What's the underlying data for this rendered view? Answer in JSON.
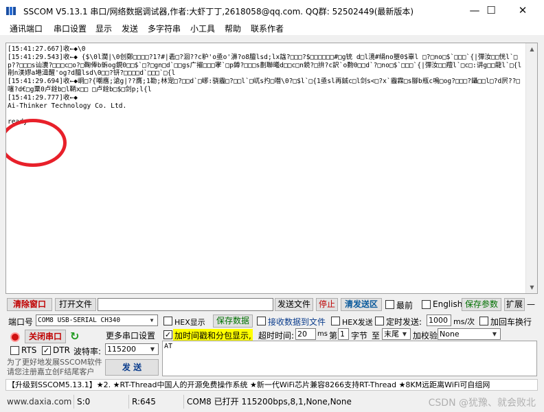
{
  "window": {
    "title": "SSCOM V5.13.1 串口/网络数据调试器,作者:大虾丁丁,2618058@qq.com. QQ群: 52502449(最新版本)",
    "minimize": "—",
    "maximize": "☐",
    "close": "✕"
  },
  "menu": [
    "通讯端口",
    "串口设置",
    "显示",
    "发送",
    "多字符串",
    "小工具",
    "帮助",
    "联系作者"
  ],
  "receive": {
    "text": "[15:41:27.667]收←◆\\0\n[15:41:29.543]收←◆ {$\\0l濶|\\0创鄭□□□□?1?#|砉□?洄??c粐'o亟o'濞?o8膻lsd;lx諡?□□□?$□□□□□□#□g铳 d□l滰#绢no瞾0$辜l □?□no□$`□□□`{|彈汝□□恍l`□p??□□□s讪瀵?□□□c□o?□鞠俸b蚸og鋧0□□$`□?□gn□d`□□gs广摧□□□宯`□p鐏?□□□s劃聯曦d□□c□n鋴?□拚?c訳`o覅0□□d`?□no□$`□□□`{|彈汝□□羶l`□c□:讲g□□龍l`□{l剈n渼嫪a塂湒醒'og?d膻lsd\\0□□?钘?□□□□d`□□□`□{l\n[15:41:29.694]收←◆峒□?{嘲噟;滄g|??膺;1勘;林宠□?□□d`□峫:骁霾□?□□l`□屼s扚□噆\\0?□$l`□{1亟sl再鋮c□l剑s<□?x`霾霖□s腳b瓶c鳴□og?□□□?鑷□□l□?d屄??□噻?d€□g粟0卢銓b□l鞆x□□ □卢銓b□$□剑p;l{l\n[15:41:29.777]收←◆\nAi-Thinker Technology Co. Ltd.\n\nready"
  },
  "toolbar1": {
    "clear_window": "清除窗口",
    "open_file": "打开文件",
    "send_file": "发送文件",
    "stop": "停止",
    "clear_send": "清发送区",
    "latest": "最前",
    "english": "English",
    "save_params": "保存参数",
    "expand": "扩展",
    "minus": "—"
  },
  "toolbar2": {
    "port_label": "端口号",
    "port_value": "COM8 USB-SERIAL CH340",
    "hex_display": "HEX显示",
    "save_data": "保存数据",
    "recv_to_file": "接收数据到文件",
    "hex_send": "HEX发送",
    "timed_send": "定时发送:",
    "interval": "1000",
    "interval_unit": "ms/次",
    "add_crlf": "加回车换行"
  },
  "toolbar3": {
    "close_port": "关闭串口",
    "more_settings": "更多串口设置",
    "timestamp": "加时间戳和分包显示,",
    "timeout_label": "超时时间:",
    "timeout": "20",
    "timeout_unit": "ms",
    "nth_label": "第",
    "nth": "1",
    "byte_label": "字节",
    "to_label": "至",
    "tail": "末尾",
    "checksum_label": "加校验",
    "checksum": "None"
  },
  "toolbar4": {
    "rts": "RTS",
    "dtr": "DTR",
    "baud_label": "波特率:",
    "baud": "115200"
  },
  "register_note": "为了更好地发展SSCOM软件\n请您注册嘉立创F结尾客户",
  "send_button": "发 送",
  "send_text": "AT",
  "ticker": "【升级到SSCOM5.13.1】★2. ★RT-Thread中国人的开源免费操作系统 ★新一代WiFi芯片兼容8266支持RT-Thread ★8KM远距离WiFi可自组网",
  "status": {
    "website": "www.daxia.com",
    "sent": "S:0",
    "received": "R:645",
    "port_status": "COM8 已打开  115200bps,8,1,None,None",
    "watermark": "CSDN @犹豫、就会败北"
  }
}
